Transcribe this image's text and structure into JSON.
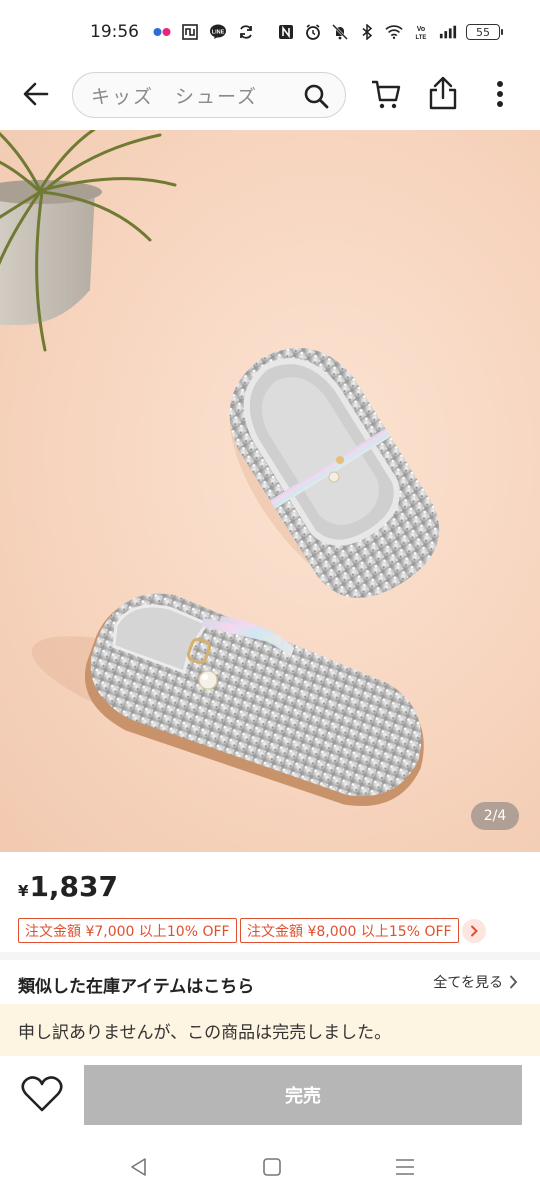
{
  "status_bar": {
    "time": "19:56",
    "battery": "55",
    "left_icons": [
      "flickr-icon",
      "media-icon",
      "line-icon",
      "sync-icon"
    ],
    "right_icons": [
      "nfc-icon",
      "alarm-icon",
      "mute-icon",
      "bluetooth-icon",
      "wifi-icon",
      "volte-icon",
      "signal-icon",
      "battery-icon"
    ]
  },
  "top_bar": {
    "search_text": "キッズ　シューズ"
  },
  "product_image": {
    "counter": "2/4",
    "description_icons": [
      "plant",
      "glitter-shoes"
    ]
  },
  "price": {
    "currency": "¥",
    "value": "1,837"
  },
  "coupons": [
    {
      "label": "注文金額 ¥7,000 以上10% OFF"
    },
    {
      "label": "注文金額 ¥8,000 以上15% OFF"
    }
  ],
  "similar": {
    "title": "類似した在庫アイテムはこちら",
    "see_all": "全てを見る"
  },
  "soldout_notice": "申し訳ありませんが、この商品は完売しました。",
  "bottom_bar": {
    "soldout_button": "完売"
  },
  "colors": {
    "coupon_red": "#e0502f",
    "soldout_grey": "#b6b6b6",
    "notice_bg": "#fdf4e2",
    "image_bg": "#f7d5bf"
  }
}
